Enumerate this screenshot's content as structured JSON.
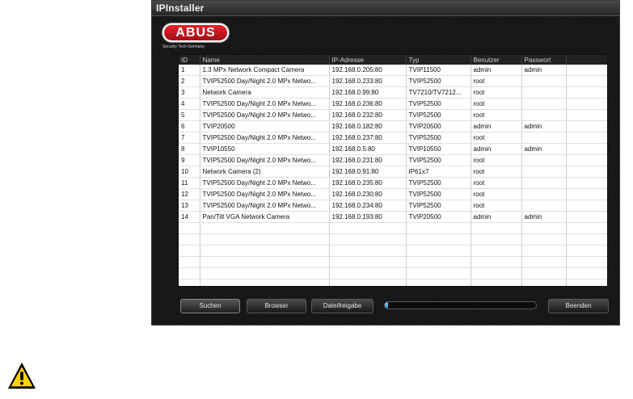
{
  "window": {
    "title": "IPInstaller"
  },
  "logo": {
    "text": "ABUS",
    "tagline": "Security Tech Germany"
  },
  "columns": [
    "ID",
    "Name",
    "IP-Adresse",
    "Typ",
    "Benutzer",
    "Passwort",
    ""
  ],
  "rows": [
    [
      "1",
      "1.3 MPx Network Compact Camera",
      "192.168.0.205:80",
      "TVIP11500",
      "admin",
      "admin",
      ""
    ],
    [
      "2",
      "TVIP52500 Day/Night 2.0 MPx Netwo...",
      "192.168.0.233:80",
      "TVIP52500",
      "root",
      "",
      ""
    ],
    [
      "3",
      "Network Camera",
      "192.168.0.99:80",
      "TV7210/TV7212...",
      "root",
      "",
      ""
    ],
    [
      "4",
      "TVIP52500 Day/Night 2.0 MPx Netwo...",
      "192.168.0.236:80",
      "TVIP52500",
      "root",
      "",
      ""
    ],
    [
      "5",
      "TVIP52500 Day/Night 2.0 MPx Netwo...",
      "192.168.0.232:80",
      "TVIP52500",
      "root",
      "",
      ""
    ],
    [
      "6",
      "TVIP20500",
      "192.168.0.182:80",
      "TVIP20500",
      "admin",
      "admin",
      ""
    ],
    [
      "7",
      "TVIP52500 Day/Night 2.0 MPx Netwo...",
      "192.168.0.237:80",
      "TVIP52500",
      "root",
      "",
      ""
    ],
    [
      "8",
      "TVIP10550",
      "192.168.0.5:80",
      "TVIP10550",
      "admin",
      "admin",
      ""
    ],
    [
      "9",
      "TVIP52500 Day/Night 2.0 MPx Netwo...",
      "192.168.0.231:80",
      "TVIP52500",
      "root",
      "",
      ""
    ],
    [
      "10",
      "Network Camera (2)",
      "192.168.0.91:80",
      "IP61x7",
      "root",
      "",
      ""
    ],
    [
      "11",
      "TVIP52500 Day/Night 2.0 MPx Netwo...",
      "192.168.0.235:80",
      "TVIP52500",
      "root",
      "",
      ""
    ],
    [
      "12",
      "TVIP52500 Day/Night 2.0 MPx Netwo...",
      "192.168.0.230:80",
      "TVIP52500",
      "root",
      "",
      ""
    ],
    [
      "13",
      "TVIP52500 Day/Night 2.0 MPx Netwo...",
      "192.168.0.234:80",
      "TVIP52500",
      "root",
      "",
      ""
    ],
    [
      "14",
      "Pan/Tilt VGA Network Camera",
      "192.168.0.193:80",
      "TVIP20500",
      "admin",
      "admin",
      ""
    ],
    [
      "",
      "",
      "",
      "",
      "",
      "",
      ""
    ],
    [
      "",
      "",
      "",
      "",
      "",
      "",
      ""
    ],
    [
      "",
      "",
      "",
      "",
      "",
      "",
      ""
    ],
    [
      "",
      "",
      "",
      "",
      "",
      "",
      ""
    ],
    [
      "",
      "",
      "",
      "",
      "",
      "",
      ""
    ],
    [
      "",
      "",
      "",
      "",
      "",
      "",
      ""
    ]
  ],
  "buttons": {
    "search": "Suchen",
    "browser": "Browser",
    "share": "Dateifreigabe",
    "exit": "Beenden"
  },
  "progress": {
    "fraction": 0.02
  },
  "icons": {
    "warning": "warning-icon"
  },
  "colors": {
    "brand_red": "#d71920",
    "window_bg": "#141414",
    "progress_blue": "#2c8fd6"
  }
}
